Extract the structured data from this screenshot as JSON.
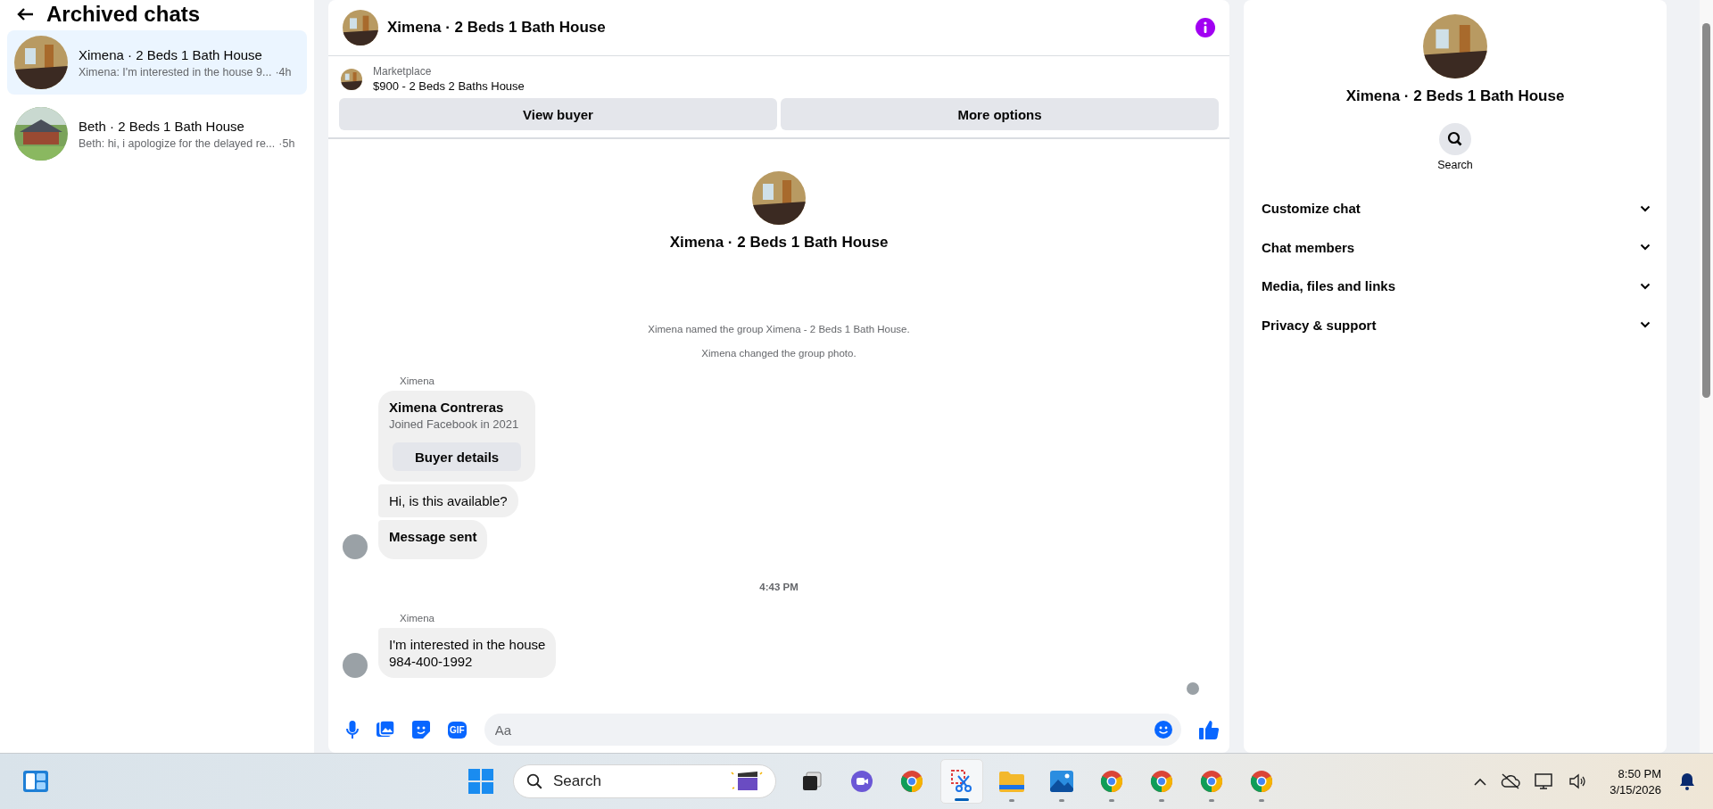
{
  "archived": {
    "title": "Archived chats",
    "chats": [
      {
        "name": "Ximena · 2 Beds 1 Bath House",
        "preview": "Ximena: I'm interested in the house 9...",
        "time": "·4h",
        "selected": true,
        "kind": "room"
      },
      {
        "name": "Beth · 2 Beds 1 Bath House",
        "preview": "Beth: hi, i apologize for the delayed re...",
        "time": "·5h",
        "selected": false,
        "kind": "house"
      }
    ]
  },
  "chat": {
    "title": "Ximena · 2 Beds 1 Bath House",
    "listing": {
      "label": "Marketplace",
      "title": "$900 - 2 Beds 2 Baths House"
    },
    "actions": [
      "View buyer",
      "More options"
    ],
    "intro_title": "Ximena · 2 Beds 1 Bath House",
    "thread": [
      {
        "kind": "system",
        "text": "Ximena named the group Ximena - 2 Beds 1 Bath House."
      },
      {
        "kind": "system",
        "text": "Ximena changed the group photo."
      },
      {
        "kind": "sender",
        "text": "Ximena"
      },
      {
        "kind": "card",
        "name": "Ximena Contreras",
        "detail": "Joined Facebook in 2021",
        "button": "Buyer details"
      },
      {
        "kind": "bubble",
        "lines": [
          "Hi, is this available?"
        ],
        "bold": false,
        "avatar": false
      },
      {
        "kind": "bubble",
        "lines": [
          "Message sent"
        ],
        "bold": true,
        "avatar": true
      },
      {
        "kind": "time",
        "text": "4:43 PM"
      },
      {
        "kind": "sender",
        "text": "Ximena"
      },
      {
        "kind": "bubble",
        "lines": [
          "I'm interested in the house",
          "984-400-1992"
        ],
        "bold": false,
        "avatar": true
      }
    ],
    "composer": {
      "placeholder": "Aa",
      "gif_label": "GIF"
    }
  },
  "details": {
    "title": "Ximena · 2 Beds 1 Bath House",
    "search_label": "Search",
    "sections": [
      {
        "label": "Customize chat",
        "expanded": false
      },
      {
        "label": "Chat members",
        "expanded": false
      },
      {
        "label": "Media, files and links",
        "expanded": false
      },
      {
        "label": "Privacy & support",
        "expanded": false
      }
    ]
  },
  "taskbar": {
    "search_placeholder": "Search",
    "time": "8:50 PM",
    "date": "3/15/2026",
    "apps": [
      {
        "kind": "taskview",
        "selected": false,
        "running": false
      },
      {
        "kind": "meet",
        "selected": false,
        "running": false
      },
      {
        "kind": "chrome",
        "selected": false,
        "running": false
      },
      {
        "kind": "snip",
        "selected": true,
        "running": true
      },
      {
        "kind": "folder",
        "selected": false,
        "running": true
      },
      {
        "kind": "photos",
        "selected": false,
        "running": true
      },
      {
        "kind": "chrome",
        "selected": false,
        "running": true
      },
      {
        "kind": "chrome",
        "selected": false,
        "running": true
      },
      {
        "kind": "chrome",
        "selected": false,
        "running": true
      },
      {
        "kind": "chrome",
        "selected": false,
        "running": true
      }
    ]
  }
}
